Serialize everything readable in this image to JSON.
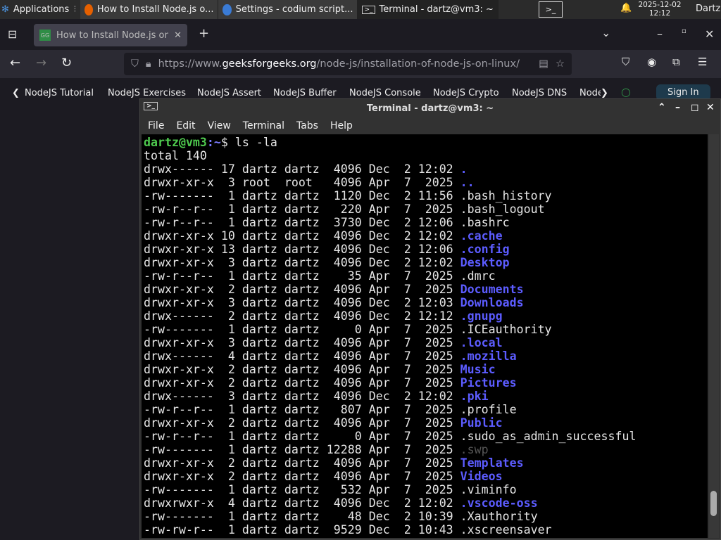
{
  "taskbar": {
    "apps_label": "Applications",
    "windows": [
      {
        "label": "How to Install Node.js o...",
        "icon": "firefox-icon"
      },
      {
        "label": "Settings - codium script...",
        "icon": "codium-icon"
      },
      {
        "label": "Terminal - dartz@vm3: ~",
        "icon": "terminal-icon"
      }
    ],
    "date": "2025-12-02",
    "time": "12:12",
    "user": "Dartz"
  },
  "browser": {
    "tab_title": "How to Install Node.js on",
    "url_prefix": "https://www.",
    "url_domain": "geeksforgeeks.org",
    "url_path": "/node-js/installation-of-node-js-on-linux/",
    "bookmarks": [
      "NodeJS Tutorial",
      "NodeJS Exercises",
      "NodeJS Assert",
      "NodeJS Buffer",
      "NodeJS Console",
      "NodeJS Crypto",
      "NodeJS DNS",
      "Node"
    ],
    "sign_in": "Sign In"
  },
  "terminal": {
    "title": "Terminal - dartz@vm3: ~",
    "menu": [
      "File",
      "Edit",
      "View",
      "Terminal",
      "Tabs",
      "Help"
    ],
    "prompt_user": "dartz@vm3",
    "prompt_path": ":~",
    "prompt_symbol": "$ ",
    "command": "ls -la",
    "total": "total 140",
    "rows": [
      [
        "drwx------",
        "17",
        "dartz",
        "dartz",
        "4096",
        "Dec",
        "2",
        "12:02",
        ".",
        "dir"
      ],
      [
        "drwxr-xr-x",
        "3",
        "root",
        "root",
        "4096",
        "Apr",
        "7",
        "2025",
        "..",
        "dir"
      ],
      [
        "-rw-------",
        "1",
        "dartz",
        "dartz",
        "1120",
        "Dec",
        "2",
        "11:56",
        ".bash_history",
        "file"
      ],
      [
        "-rw-r--r--",
        "1",
        "dartz",
        "dartz",
        "220",
        "Apr",
        "7",
        "2025",
        ".bash_logout",
        "file"
      ],
      [
        "-rw-r--r--",
        "1",
        "dartz",
        "dartz",
        "3730",
        "Dec",
        "2",
        "12:06",
        ".bashrc",
        "file"
      ],
      [
        "drwxr-xr-x",
        "10",
        "dartz",
        "dartz",
        "4096",
        "Dec",
        "2",
        "12:02",
        ".cache",
        "dir"
      ],
      [
        "drwxr-xr-x",
        "13",
        "dartz",
        "dartz",
        "4096",
        "Dec",
        "2",
        "12:06",
        ".config",
        "dir"
      ],
      [
        "drwxr-xr-x",
        "3",
        "dartz",
        "dartz",
        "4096",
        "Dec",
        "2",
        "12:02",
        "Desktop",
        "dir"
      ],
      [
        "-rw-r--r--",
        "1",
        "dartz",
        "dartz",
        "35",
        "Apr",
        "7",
        "2025",
        ".dmrc",
        "file"
      ],
      [
        "drwxr-xr-x",
        "2",
        "dartz",
        "dartz",
        "4096",
        "Apr",
        "7",
        "2025",
        "Documents",
        "dir"
      ],
      [
        "drwxr-xr-x",
        "3",
        "dartz",
        "dartz",
        "4096",
        "Dec",
        "2",
        "12:03",
        "Downloads",
        "dir"
      ],
      [
        "drwx------",
        "2",
        "dartz",
        "dartz",
        "4096",
        "Dec",
        "2",
        "12:12",
        ".gnupg",
        "dir"
      ],
      [
        "-rw-------",
        "1",
        "dartz",
        "dartz",
        "0",
        "Apr",
        "7",
        "2025",
        ".ICEauthority",
        "file"
      ],
      [
        "drwxr-xr-x",
        "3",
        "dartz",
        "dartz",
        "4096",
        "Apr",
        "7",
        "2025",
        ".local",
        "dir"
      ],
      [
        "drwx------",
        "4",
        "dartz",
        "dartz",
        "4096",
        "Apr",
        "7",
        "2025",
        ".mozilla",
        "dir"
      ],
      [
        "drwxr-xr-x",
        "2",
        "dartz",
        "dartz",
        "4096",
        "Apr",
        "7",
        "2025",
        "Music",
        "dir"
      ],
      [
        "drwxr-xr-x",
        "2",
        "dartz",
        "dartz",
        "4096",
        "Apr",
        "7",
        "2025",
        "Pictures",
        "dir"
      ],
      [
        "drwx------",
        "3",
        "dartz",
        "dartz",
        "4096",
        "Dec",
        "2",
        "12:02",
        ".pki",
        "dir"
      ],
      [
        "-rw-r--r--",
        "1",
        "dartz",
        "dartz",
        "807",
        "Apr",
        "7",
        "2025",
        ".profile",
        "file"
      ],
      [
        "drwxr-xr-x",
        "2",
        "dartz",
        "dartz",
        "4096",
        "Apr",
        "7",
        "2025",
        "Public",
        "dir"
      ],
      [
        "-rw-r--r--",
        "1",
        "dartz",
        "dartz",
        "0",
        "Apr",
        "7",
        "2025",
        ".sudo_as_admin_successful",
        "file"
      ],
      [
        "-rw-------",
        "1",
        "dartz",
        "dartz",
        "12288",
        "Apr",
        "7",
        "2025",
        ".swp",
        "dim"
      ],
      [
        "drwxr-xr-x",
        "2",
        "dartz",
        "dartz",
        "4096",
        "Apr",
        "7",
        "2025",
        "Templates",
        "dir"
      ],
      [
        "drwxr-xr-x",
        "2",
        "dartz",
        "dartz",
        "4096",
        "Apr",
        "7",
        "2025",
        "Videos",
        "dir"
      ],
      [
        "-rw-------",
        "1",
        "dartz",
        "dartz",
        "532",
        "Apr",
        "7",
        "2025",
        ".viminfo",
        "file"
      ],
      [
        "drwxrwxr-x",
        "4",
        "dartz",
        "dartz",
        "4096",
        "Dec",
        "2",
        "12:02",
        ".vscode-oss",
        "dir"
      ],
      [
        "-rw-------",
        "1",
        "dartz",
        "dartz",
        "48",
        "Dec",
        "2",
        "10:39",
        ".Xauthority",
        "file"
      ],
      [
        "-rw-rw-r--",
        "1",
        "dartz",
        "dartz",
        "9529",
        "Dec",
        "2",
        "10:43",
        ".xscreensaver",
        "file"
      ]
    ],
    "scroll_position_percent": 95
  }
}
